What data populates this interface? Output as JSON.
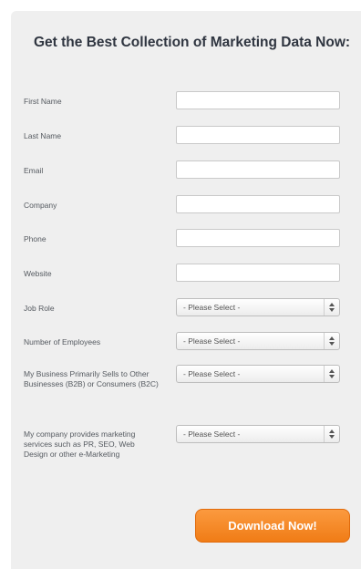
{
  "form": {
    "title": "Get the Best Collection of Marketing Data Now:",
    "fields": {
      "first_name": "First Name",
      "last_name": "Last Name",
      "email": "Email",
      "company": "Company",
      "phone": "Phone",
      "website": "Website"
    },
    "selects": {
      "job_role": {
        "label": "Job Role",
        "value": "- Please Select -"
      },
      "employees": {
        "label": "Number of Employees",
        "value": "- Please Select -"
      },
      "sells_to": {
        "label": "My Business Primarily Sells to Other Businesses (B2B) or Consumers (B2C)",
        "value": "- Please Select -"
      },
      "services": {
        "label": "My company provides marketing services such as PR, SEO, Web Design or other e-Marketing",
        "value": "- Please Select -"
      }
    },
    "submit_label": "Download Now!"
  },
  "colors": {
    "panel_bg": "#efefef",
    "title": "#2f3540",
    "button": "#f07c16"
  }
}
